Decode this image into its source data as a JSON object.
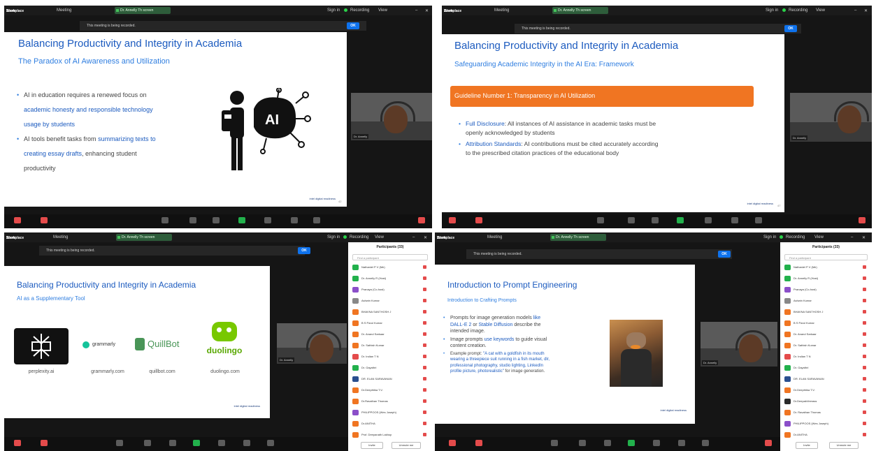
{
  "common": {
    "brand_line1": "Zoom",
    "brand_line2": "Workplace",
    "meeting_label": "Meeting",
    "share_tab_label": "Dr. Annelly Th screen",
    "sign_in": "Sign in",
    "recording": "Recording",
    "view": "View",
    "notice_text": "This meeting is being recorded.",
    "ok_label": "OK",
    "intel_label": "intel digital readiness",
    "toolbar_labels": [
      "Audio",
      "Video",
      "Participants",
      "Chat",
      "React",
      "Share",
      "AI Companion",
      "Apps",
      "More",
      "Leave"
    ]
  },
  "panel1": {
    "title": "Balancing Productivity and Integrity in Academia",
    "subtitle": "The Paradox of AI Awareness and Utilization",
    "bullet1_a": "AI in education requires a renewed focus on",
    "bullet1_b": "academic honesty and responsible technology",
    "bullet1_c": "usage by students",
    "bullet2_a": "AI tools benefit tasks from",
    "bullet2_b": "summarizing texts to",
    "bullet2_c": "creating essay drafts",
    "bullet2_d": ", enhancing student",
    "bullet2_e": "productivity",
    "ai_label": "AI",
    "page_num": "42"
  },
  "panel2": {
    "title": "Balancing Productivity and Integrity in Academia",
    "subtitle": "Safeguarding Academic Integrity in the AI Era: Framework",
    "guideline": "Guideline Number 1: Transparency in AI Utilization",
    "b1_head": "Full Disclosure",
    "b1_text": ": All instances of AI assistance in academic tasks must be",
    "b1_text2": "openly acknowledged by students",
    "b2_head": "Attribution Standards",
    "b2_text": ": AI contributions must be cited accurately according",
    "b2_text2": "to the prescribed citation practices of the educational body",
    "page_num": "47"
  },
  "panel3": {
    "title": "Balancing Productivity and Integrity in Academia",
    "subtitle": "AI as a Supplementary Tool",
    "logos": [
      {
        "name": "perplexity",
        "caption": "perplexity.ai"
      },
      {
        "name": "grammarly",
        "caption": "grammarly.com"
      },
      {
        "name": "QuillBot",
        "caption": "quillbot.com"
      },
      {
        "name": "duolingo",
        "caption": "duolingo.com"
      }
    ],
    "participants_title": "Participants (33)",
    "search_placeholder": "Find a participant",
    "invite": "Invite",
    "unmute_all": "Unmute me"
  },
  "panel4": {
    "title": "Introduction to Prompt Engineering",
    "subtitle": "Introduction to Crafting Prompts",
    "b1_a": "Prompts for image generation models",
    "b1_b": "like",
    "b1_c": "DALL-E 2",
    "b1_d": "or",
    "b1_e": "Stable Diffusion",
    "b1_f": "describe the",
    "b1_g": "intended image.",
    "b2_a": "Image prompts",
    "b2_b": "use keywords",
    "b2_c": "to guide visual",
    "b2_d": "content creation.",
    "b3_a": "Example prompt:",
    "b3_b": "\"A cat with a goldfish in its mouth",
    "b3_c": "wearing a threepiece suit running in a fish market, dlr,",
    "b3_d": "professional photography, studio lighting, LinkedIn",
    "b3_e": "profile picture, photorealistic\"",
    "b3_f": "for image generation.",
    "participants_title": "Participants (33)",
    "search_placeholder": "Find a participant",
    "invite": "Invite",
    "unmute_all": "Unmute me"
  },
  "participants": [
    {
      "name": "Nathaniel P V (Me)",
      "color": "#22b14c"
    },
    {
      "name": "Dr. Annelly R (Host)",
      "color": "#22b14c"
    },
    {
      "name": "Pranaya (Co-host)",
      "color": "#8b4fc9"
    },
    {
      "name": "Ashwin Kumar",
      "color": "#888888"
    },
    {
      "name": "BHAVNA SANTHOSH J",
      "color": "#f07522"
    },
    {
      "name": "B S Parul Kumar",
      "color": "#f07522"
    },
    {
      "name": "Dr. Anand Sarkaar",
      "color": "#f07522"
    },
    {
      "name": "Dr. Sathish Kumar",
      "color": "#f07522"
    },
    {
      "name": "Dr. Indian T N",
      "color": "#e44b4b"
    },
    {
      "name": "Dr. Gayathri",
      "color": "#22b14c"
    },
    {
      "name": "DR. ELAN SARAVANAN",
      "color": "#2a4f8f"
    },
    {
      "name": "Dr.Deepthika T.V.",
      "color": "#f07522"
    },
    {
      "name": "Dr.Ravathan Thomas",
      "color": "#f07522"
    },
    {
      "name": "PHILIPPOOS (Wes Joseph)",
      "color": "#8b4fc9"
    },
    {
      "name": "Dr.ANITHA",
      "color": "#f07522"
    },
    {
      "name": "Prof. Deepanath Lakhop",
      "color": "#f07522"
    }
  ],
  "participants4": [
    {
      "name": "Nathaniel P V (Me)",
      "color": "#22b14c"
    },
    {
      "name": "Dr. Annelly R (Host)",
      "color": "#22b14c"
    },
    {
      "name": "Pranaya (Co-host)",
      "color": "#8b4fc9"
    },
    {
      "name": "Ashwin Kumar",
      "color": "#888888"
    },
    {
      "name": "BHAVNA SANTHOSH J",
      "color": "#f07522"
    },
    {
      "name": "B S Parul Kumar",
      "color": "#f07522"
    },
    {
      "name": "Dr. Anand Sarkaar",
      "color": "#f07522"
    },
    {
      "name": "Dr. Sathish Kumar",
      "color": "#f07522"
    },
    {
      "name": "Dr. Indian T N",
      "color": "#e44b4b"
    },
    {
      "name": "Dr. Gayathri",
      "color": "#22b14c"
    },
    {
      "name": "DR. ELAN SARAVANAN",
      "color": "#2a4f8f"
    },
    {
      "name": "Dr.Deepthika T.V.",
      "color": "#f07522"
    },
    {
      "name": "Dr.DeepakVeerass",
      "color": "#2a2a2a"
    },
    {
      "name": "Dr. Ravathan Thomas",
      "color": "#f07522"
    },
    {
      "name": "PHILIPPOOS (Wes Joseph)",
      "color": "#8b4fc9"
    },
    {
      "name": "Dr.ANITHA",
      "color": "#f07522"
    }
  ]
}
